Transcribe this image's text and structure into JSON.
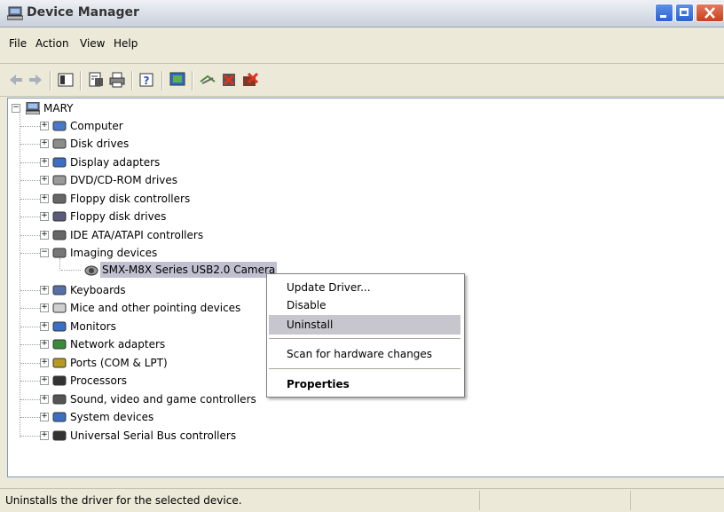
{
  "window": {
    "title": "Device Manager"
  },
  "menu": [
    "File",
    "Action",
    "View",
    "Help"
  ],
  "toolbar": {
    "buttons": [
      "back-icon",
      "forward-icon",
      "console-tree-icon",
      "properties-icon",
      "print-icon",
      "help-icon",
      "update-driver-icon",
      "scan-icon",
      "disable-icon",
      "uninstall-icon"
    ]
  },
  "tree": {
    "root": "MARY",
    "categories": [
      {
        "label": "Computer",
        "icon": "computer-icon"
      },
      {
        "label": "Disk drives",
        "icon": "disk-drive-icon"
      },
      {
        "label": "Display adapters",
        "icon": "display-icon"
      },
      {
        "label": "DVD/CD-ROM drives",
        "icon": "dvd-icon"
      },
      {
        "label": "Floppy disk controllers",
        "icon": "controller-icon"
      },
      {
        "label": "Floppy disk drives",
        "icon": "floppy-icon"
      },
      {
        "label": "IDE ATA/ATAPI controllers",
        "icon": "ide-icon"
      },
      {
        "label": "Imaging devices",
        "icon": "camera-icon"
      },
      {
        "label": "Keyboards",
        "icon": "keyboard-icon"
      },
      {
        "label": "Mice and other pointing devices",
        "icon": "mouse-icon"
      },
      {
        "label": "Monitors",
        "icon": "monitor-icon"
      },
      {
        "label": "Network adapters",
        "icon": "network-icon"
      },
      {
        "label": "Ports (COM & LPT)",
        "icon": "port-icon"
      },
      {
        "label": "Processors",
        "icon": "processor-icon"
      },
      {
        "label": "Sound, video and game controllers",
        "icon": "sound-icon"
      },
      {
        "label": "System devices",
        "icon": "system-icon"
      },
      {
        "label": "Universal Serial Bus controllers",
        "icon": "usb-icon"
      }
    ],
    "imaging_child": "SMX-M8X Series USB2.0 Camera"
  },
  "context_menu": {
    "items": [
      "Update Driver...",
      "Disable",
      "Uninstall",
      "Scan for hardware changes",
      "Properties"
    ],
    "highlighted": "Uninstall"
  },
  "status": {
    "text": "Uninstalls the driver for the selected device."
  }
}
